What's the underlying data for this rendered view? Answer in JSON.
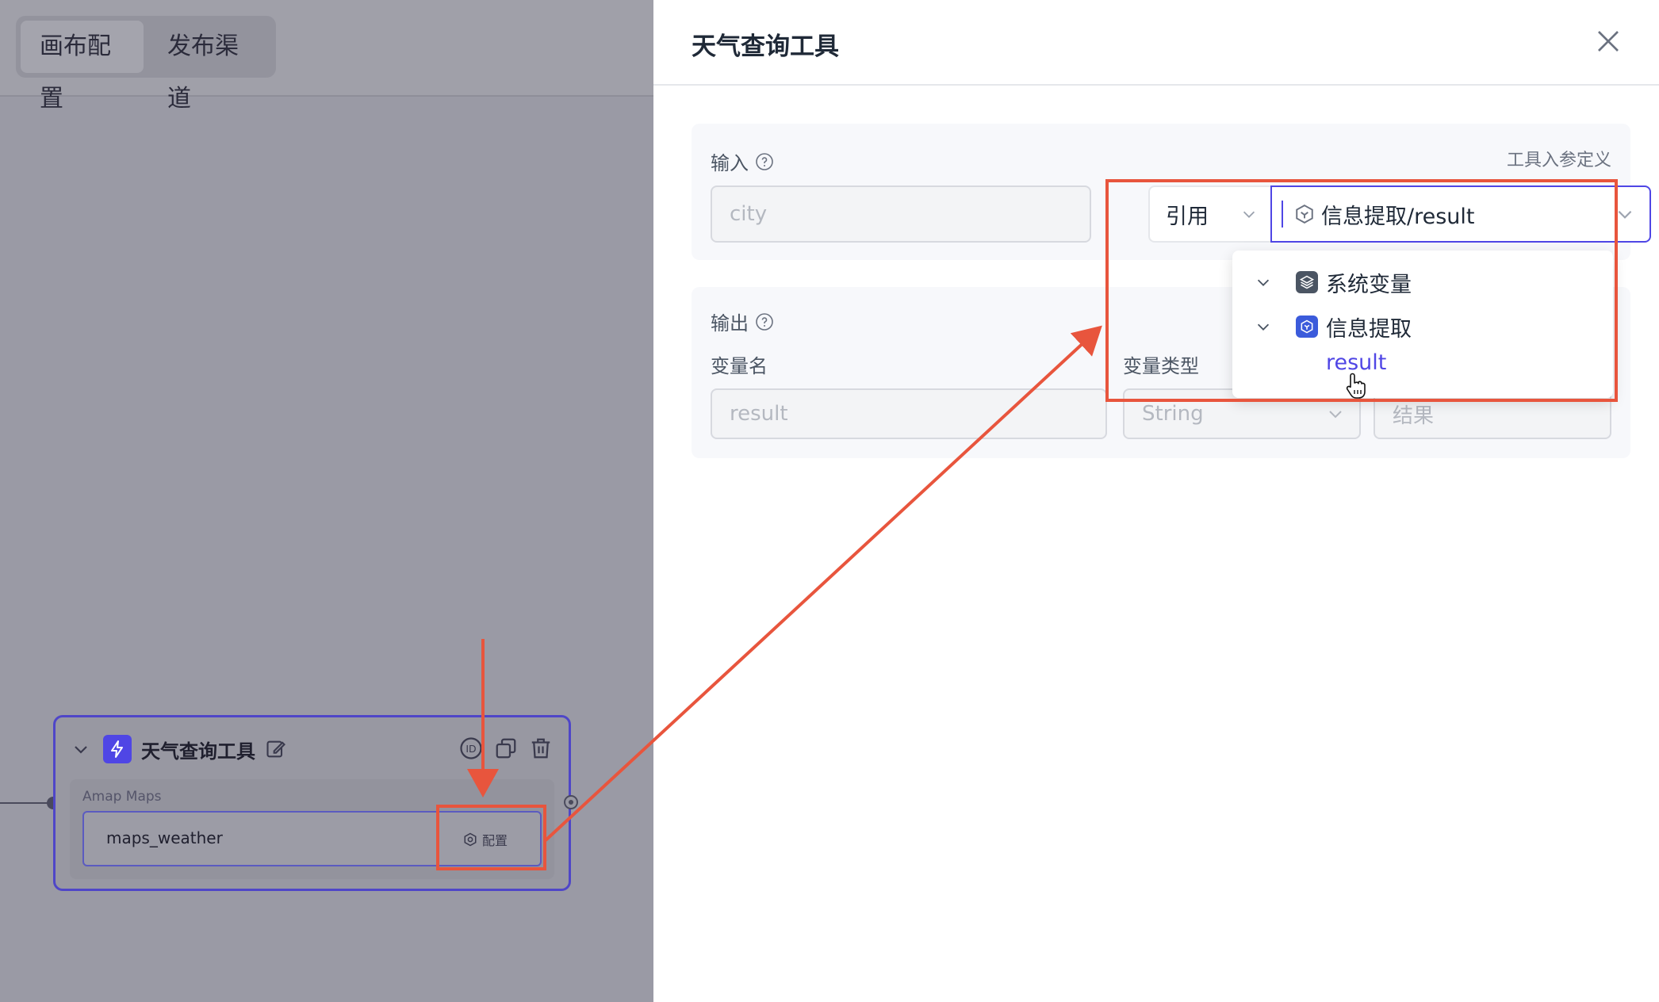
{
  "canvas": {
    "tabs": [
      {
        "label": "画布配置",
        "active": true
      },
      {
        "label": "发布渠道",
        "active": false
      }
    ],
    "node": {
      "title": "天气查询工具",
      "subtitle": "Amap Maps",
      "tool_name": "maps_weather",
      "config_label": "配置"
    }
  },
  "drawer": {
    "title": "天气查询工具",
    "input": {
      "label": "输入",
      "tool_param_link": "工具入参定义",
      "param_name": "city",
      "ref_mode": "引用",
      "ref_value": "信息提取/result"
    },
    "dropdown": {
      "groups": [
        {
          "label": "系统变量",
          "icon": "layers-icon",
          "color": "#4b5563"
        },
        {
          "label": "信息提取",
          "icon": "cube-icon",
          "color": "#3b5bdb"
        }
      ],
      "leaf": "result"
    },
    "output": {
      "label": "输出",
      "col_name": "变量名",
      "col_type": "变量类型",
      "var_name": "result",
      "var_type": "String",
      "var_desc": "结果"
    }
  },
  "colors": {
    "accent": "#4f46e5",
    "annotation": "#e8553d"
  }
}
